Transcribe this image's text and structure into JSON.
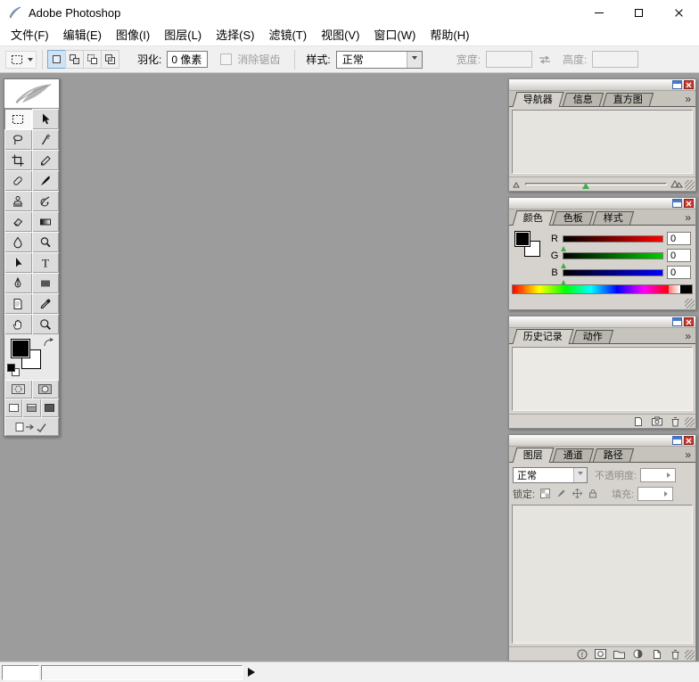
{
  "window": {
    "title": "Adobe Photoshop"
  },
  "menubar": {
    "items": [
      "文件(F)",
      "编辑(E)",
      "图像(I)",
      "图层(L)",
      "选择(S)",
      "滤镜(T)",
      "视图(V)",
      "窗口(W)",
      "帮助(H)"
    ]
  },
  "options": {
    "feather_label": "羽化:",
    "feather_value": "0 像素",
    "antialias_label": "消除锯齿",
    "style_label": "样式:",
    "style_value": "正常",
    "width_label": "宽度:",
    "width_value": "",
    "height_label": "高度:",
    "height_value": ""
  },
  "toolbox": {
    "tools": [
      "rectangular-marquee",
      "move",
      "lasso",
      "magic-wand",
      "crop",
      "slice",
      "healing-brush",
      "brush",
      "clone-stamp",
      "history-brush",
      "eraser",
      "gradient",
      "blur",
      "dodge",
      "path-selection",
      "type",
      "pen",
      "rectangle",
      "notes",
      "eyedropper",
      "hand",
      "zoom"
    ],
    "active_tool": "rectangular-marquee"
  },
  "panels": {
    "menu_glyph": "»",
    "navigator": {
      "tabs": [
        "导航器",
        "信息",
        "直方图"
      ],
      "active": "导航器"
    },
    "color": {
      "tabs": [
        "颜色",
        "色板",
        "样式"
      ],
      "active": "颜色",
      "channels": [
        {
          "label": "R",
          "value": "0"
        },
        {
          "label": "G",
          "value": "0"
        },
        {
          "label": "B",
          "value": "0"
        }
      ]
    },
    "history": {
      "tabs": [
        "历史记录",
        "动作"
      ],
      "active": "历史记录"
    },
    "layers": {
      "tabs": [
        "图层",
        "通道",
        "路径"
      ],
      "active": "图层",
      "blend_mode": "正常",
      "opacity_label": "不透明度:",
      "opacity_value": "",
      "lock_label": "锁定:",
      "fill_label": "填充:",
      "fill_value": ""
    }
  },
  "colors": {
    "canvas": "#9c9c9c",
    "panel": "#d6d3ce",
    "close_button": "#cb3a30",
    "foreground": "#000000",
    "background_swatch": "#ffffff"
  }
}
